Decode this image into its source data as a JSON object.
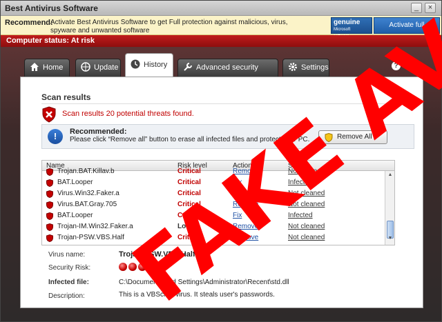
{
  "window": {
    "title": "Best Antivirus Software",
    "minimize_symbol": "_",
    "close_symbol": "×"
  },
  "recommend_bar": {
    "label": "Recommend:",
    "text": "Activate Best Antivirus Software to get Full protection against malicious, virus, spyware and unwanted software",
    "genuine_line1": "genuine",
    "genuine_line2": "Microsoft",
    "genuine_line3": "software",
    "activate_button": "Activate full protection"
  },
  "status_bar": {
    "text": "Computer status: At risk"
  },
  "tabs": [
    {
      "id": "home",
      "label": "Home"
    },
    {
      "id": "update",
      "label": "Update"
    },
    {
      "id": "history",
      "label": "History"
    },
    {
      "id": "advanced",
      "label": "Advanced security settings"
    },
    {
      "id": "settings",
      "label": "Settings"
    }
  ],
  "help_label": "Help",
  "scan": {
    "title": "Scan results",
    "threat_message": "Scan results 20 potential threats found.",
    "recommended_title": "Recommended:",
    "recommended_text": "Please click “Remove all” button to erase all infected files and protect your PC.",
    "remove_all_button": "Remove All"
  },
  "table": {
    "columns": {
      "name": "Name",
      "risk": "Risk level",
      "action": "Action",
      "status": "Status"
    },
    "rows": [
      {
        "name": "Trojan.BAT.Killav.b",
        "risk": "Critical",
        "risk_class": "critical",
        "action": "Remove",
        "status": "Not cleaned"
      },
      {
        "name": "BAT.Looper",
        "risk": "Critical",
        "risk_class": "critical",
        "action": "Fix",
        "status": "Infected"
      },
      {
        "name": "Virus.Win32.Faker.a",
        "risk": "Critical",
        "risk_class": "critical",
        "action": "Remove",
        "status": "Not cleaned"
      },
      {
        "name": "Virus.BAT.Gray.705",
        "risk": "Critical",
        "risk_class": "critical",
        "action": "Remove",
        "status": "Not cleaned"
      },
      {
        "name": "BAT.Looper",
        "risk": "Critical",
        "risk_class": "critical",
        "action": "Fix",
        "status": "Infected"
      },
      {
        "name": "Trojan-IM.Win32.Faker.a",
        "risk": "Low",
        "risk_class": "low",
        "action": "Remove",
        "status": "Not cleaned"
      },
      {
        "name": "Trojan-PSW.VBS.Half",
        "risk": "Critical",
        "risk_class": "critical",
        "action": "Remove",
        "status": "Not cleaned"
      }
    ]
  },
  "details": {
    "virus_name_label": "Virus name:",
    "virus_name_value": "Trojan-PSW.VBS.Half",
    "security_risk_label": "Security Risk:",
    "security_risk_level": 5,
    "infected_file_label": "Infected file:",
    "infected_file_value": "C:\\Documents and Settings\\Administrator\\Recent\\std.dll",
    "description_label": "Description:",
    "description_value": "This is a VBScript-virus. It steals user's passwords."
  },
  "stamp_text": "FAKE AV",
  "colors": {
    "danger": "#c00000",
    "link": "#1d4fa3",
    "status_red": "#c01c1c",
    "tab_dark": "#3b3b3b"
  }
}
